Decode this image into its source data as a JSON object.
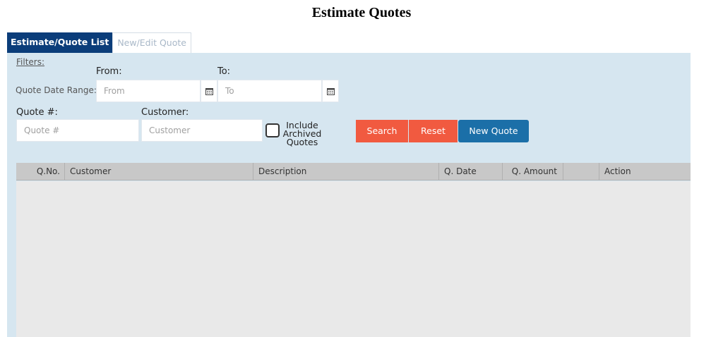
{
  "title": "Estimate Quotes",
  "tabs": [
    {
      "label": "Estimate/Quote List",
      "active": true
    },
    {
      "label": "New/Edit Quote",
      "active": false
    }
  ],
  "filters": {
    "label": "Filters:",
    "date_range_label": "Quote Date Range:",
    "from_label": "From:",
    "from_placeholder": "From",
    "to_label": "To:",
    "to_placeholder": "To",
    "quote_no_label": "Quote #:",
    "quote_no_placeholder": "Quote #",
    "customer_label": "Customer:",
    "customer_placeholder": "Customer",
    "include_archived_lines": [
      "Include",
      "Archived",
      "Quotes"
    ],
    "include_archived_checked": false
  },
  "buttons": {
    "search": "Search",
    "reset": "Reset",
    "new_quote": "New Quote"
  },
  "table": {
    "columns": [
      "Q.No.",
      "Customer",
      "Description",
      "Q. Date",
      "Q. Amount",
      "",
      "Action"
    ],
    "rows": []
  },
  "colors": {
    "tab_active": "#0b3d7a",
    "panel_bg": "#d6e6f0",
    "search_btn": "#f15a40",
    "new_quote_btn": "#1b6fa8"
  },
  "icons": {
    "from_calendar": "calendar-icon",
    "to_calendar": "calendar-icon"
  }
}
